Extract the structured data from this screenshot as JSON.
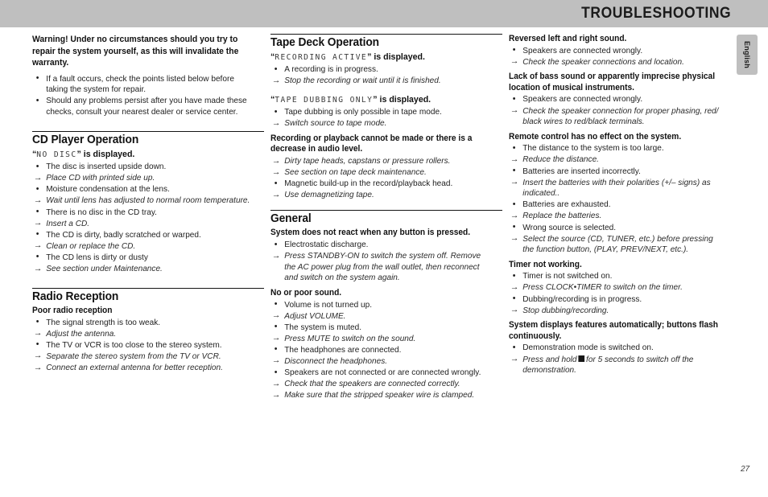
{
  "header": {
    "title": "TROUBLESHOOTING",
    "bar_color": "#bfbfbf"
  },
  "language_tab": {
    "label": "English"
  },
  "page_number": "27",
  "columns": {
    "left": {
      "warning": "Warning!  Under no circumstances should you try to repair the system yourself, as this will invalidate the warranty.",
      "warning_items": [
        "If a fault occurs, check the points listed below before taking the system for repair.",
        "Should any problems persist after you have made these checks, consult your nearest dealer or service center."
      ],
      "sections": [
        {
          "title": "CD Player Operation",
          "lcd_prefix": "“",
          "lcd_text": "NO DISC",
          "lcd_suffix": "” is displayed.",
          "items": [
            {
              "type": "cause",
              "text": "The disc is inserted upside down."
            },
            {
              "type": "fix",
              "text": "Place CD with printed side up."
            },
            {
              "type": "cause",
              "text": "Moisture condensation at the lens."
            },
            {
              "type": "fix",
              "text": "Wait until lens has adjusted to normal room temperature."
            },
            {
              "type": "cause",
              "text": "There is no disc in the CD tray."
            },
            {
              "type": "fix",
              "text": "Insert a CD."
            },
            {
              "type": "cause",
              "text": "The CD is dirty, badly scratched or warped."
            },
            {
              "type": "fix",
              "text": "Clean or replace the CD."
            },
            {
              "type": "cause",
              "text": "The CD lens is dirty or dusty"
            },
            {
              "type": "fix",
              "text": "See section under Maintenance."
            }
          ]
        },
        {
          "title": "Radio Reception",
          "subheading": "Poor radio reception",
          "items": [
            {
              "type": "cause",
              "text": "The signal strength is too weak."
            },
            {
              "type": "fix",
              "text": "Adjust the antenna."
            },
            {
              "type": "cause",
              "text": "The TV or VCR is too close to the stereo system."
            },
            {
              "type": "fix",
              "text": "Separate the stereo system from the TV or VCR."
            },
            {
              "type": "fix",
              "text": "Connect an external antenna for better reception."
            }
          ]
        }
      ]
    },
    "middle": {
      "sections": [
        {
          "title": "Tape Deck Operation",
          "groups": [
            {
              "lcd_prefix": "“",
              "lcd_text": "RECORDING ACTIVE",
              "lcd_suffix": "” is displayed.",
              "items": [
                {
                  "type": "cause",
                  "text": "A recording is in progress."
                },
                {
                  "type": "fix",
                  "text": "Stop the recording or wait until it is finished."
                }
              ]
            },
            {
              "lcd_prefix": "“",
              "lcd_text": "TAPE DUBBING ONLY",
              "lcd_suffix": "” is displayed.",
              "items": [
                {
                  "type": "cause",
                  "text": "Tape dubbing is only possible in tape mode."
                },
                {
                  "type": "fix",
                  "text": "Switch source to tape mode."
                }
              ]
            },
            {
              "heading": "Recording or playback cannot be made or there is a decrease in audio level.",
              "items": [
                {
                  "type": "cause",
                  "text": "Dirty tape heads, capstans or pressure rollers.",
                  "italic": true
                },
                {
                  "type": "fix",
                  "text": "See section on tape deck maintenance."
                },
                {
                  "type": "cause",
                  "text": "Magnetic build-up in the record/playback head."
                },
                {
                  "type": "fix",
                  "text": "Use demagnetizing tape."
                }
              ]
            }
          ]
        },
        {
          "title": "General",
          "groups": [
            {
              "heading": "System does not react when any button is pressed.",
              "items": [
                {
                  "type": "cause",
                  "text": "Electrostatic discharge."
                },
                {
                  "type": "fix",
                  "text": "Press STANDBY-ON to switch the system off. Remove the AC power plug from the wall outlet, then reconnect and switch on the system again."
                }
              ]
            },
            {
              "heading": "No or poor sound.",
              "items": [
                {
                  "type": "cause",
                  "text": "Volume is not turned up."
                },
                {
                  "type": "fix",
                  "text": "Adjust VOLUME."
                },
                {
                  "type": "cause",
                  "text": "The system is muted."
                },
                {
                  "type": "fix",
                  "text": "Press MUTE to switch on the sound."
                },
                {
                  "type": "cause",
                  "text": "The headphones are connected."
                },
                {
                  "type": "fix",
                  "text": "Disconnect the headphones."
                },
                {
                  "type": "cause",
                  "text": "Speakers are not connected or are connected wrongly."
                },
                {
                  "type": "fix",
                  "text": "Check that the speakers are connected correctly."
                },
                {
                  "type": "fix",
                  "text": "Make sure that the stripped speaker wire is clamped."
                }
              ]
            }
          ]
        }
      ]
    },
    "right": {
      "groups": [
        {
          "heading": "Reversed left and right sound.",
          "items": [
            {
              "type": "cause",
              "text": "Speakers are connected wrongly."
            },
            {
              "type": "fix",
              "text": "Check the speaker connections and location."
            }
          ]
        },
        {
          "heading": "Lack of bass sound or apparently imprecise physical location of musical instruments.",
          "items": [
            {
              "type": "cause",
              "text": "Speakers are connected wrongly."
            },
            {
              "type": "fix",
              "text": "Check the speaker connection for proper phasing, red/ black wires to red/black terminals."
            }
          ]
        },
        {
          "heading": "Remote control has no effect on the system.",
          "items": [
            {
              "type": "cause",
              "text": "The distance to the system is too large."
            },
            {
              "type": "fix",
              "text": "Reduce the distance."
            },
            {
              "type": "cause",
              "text": "Batteries are inserted incorrectly."
            },
            {
              "type": "fix",
              "text": "Insert the batteries with their polarities (+/– signs) as indicated.."
            },
            {
              "type": "cause",
              "text": "Batteries are exhausted."
            },
            {
              "type": "fix",
              "text": "Replace the batteries."
            },
            {
              "type": "cause",
              "text": "Wrong source is selected."
            },
            {
              "type": "fix",
              "text": "Select the source (CD, TUNER, etc.) before pressing the function button, (PLAY, PREV/NEXT, etc.)."
            }
          ]
        },
        {
          "heading": "Timer not working.",
          "items": [
            {
              "type": "cause",
              "text": "Timer is not switched on."
            },
            {
              "type": "fix",
              "text": "Press CLOCK•TIMER to switch on the timer."
            },
            {
              "type": "cause",
              "text": "Dubbing/recording is in progress."
            },
            {
              "type": "fix",
              "text": "Stop dubbing/recording."
            }
          ]
        },
        {
          "heading": "System displays features automatically; buttons flash continuously.",
          "items": [
            {
              "type": "cause",
              "text": "Demonstration mode is switched on."
            },
            {
              "type": "fix_block",
              "text_before": "Press and hold",
              "text_after": "for 5 seconds to switch off the demonstration."
            }
          ]
        }
      ]
    }
  }
}
